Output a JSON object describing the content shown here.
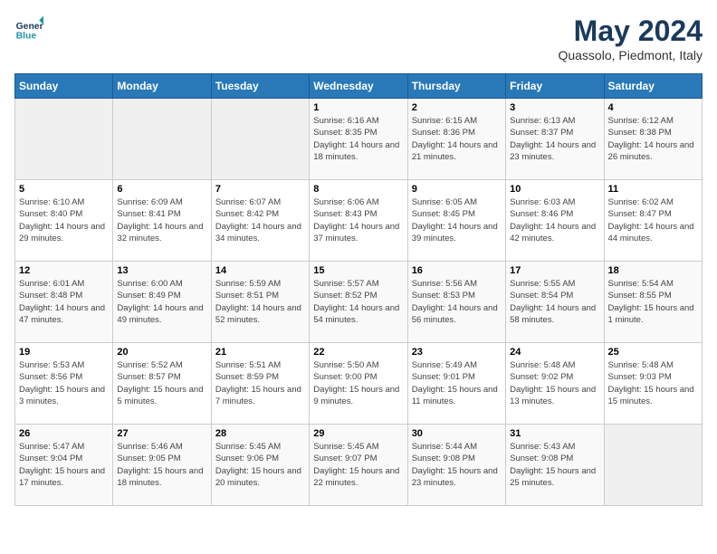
{
  "logo": {
    "text_general": "General",
    "text_blue": "Blue"
  },
  "header": {
    "title": "May 2024",
    "subtitle": "Quassolo, Piedmont, Italy"
  },
  "days_of_week": [
    "Sunday",
    "Monday",
    "Tuesday",
    "Wednesday",
    "Thursday",
    "Friday",
    "Saturday"
  ],
  "weeks": [
    [
      {
        "day": "",
        "empty": true
      },
      {
        "day": "",
        "empty": true
      },
      {
        "day": "",
        "empty": true
      },
      {
        "day": "1",
        "sunrise": "6:16 AM",
        "sunset": "8:35 PM",
        "daylight": "14 hours and 18 minutes."
      },
      {
        "day": "2",
        "sunrise": "6:15 AM",
        "sunset": "8:36 PM",
        "daylight": "14 hours and 21 minutes."
      },
      {
        "day": "3",
        "sunrise": "6:13 AM",
        "sunset": "8:37 PM",
        "daylight": "14 hours and 23 minutes."
      },
      {
        "day": "4",
        "sunrise": "6:12 AM",
        "sunset": "8:38 PM",
        "daylight": "14 hours and 26 minutes."
      }
    ],
    [
      {
        "day": "5",
        "sunrise": "6:10 AM",
        "sunset": "8:40 PM",
        "daylight": "14 hours and 29 minutes."
      },
      {
        "day": "6",
        "sunrise": "6:09 AM",
        "sunset": "8:41 PM",
        "daylight": "14 hours and 32 minutes."
      },
      {
        "day": "7",
        "sunrise": "6:07 AM",
        "sunset": "8:42 PM",
        "daylight": "14 hours and 34 minutes."
      },
      {
        "day": "8",
        "sunrise": "6:06 AM",
        "sunset": "8:43 PM",
        "daylight": "14 hours and 37 minutes."
      },
      {
        "day": "9",
        "sunrise": "6:05 AM",
        "sunset": "8:45 PM",
        "daylight": "14 hours and 39 minutes."
      },
      {
        "day": "10",
        "sunrise": "6:03 AM",
        "sunset": "8:46 PM",
        "daylight": "14 hours and 42 minutes."
      },
      {
        "day": "11",
        "sunrise": "6:02 AM",
        "sunset": "8:47 PM",
        "daylight": "14 hours and 44 minutes."
      }
    ],
    [
      {
        "day": "12",
        "sunrise": "6:01 AM",
        "sunset": "8:48 PM",
        "daylight": "14 hours and 47 minutes."
      },
      {
        "day": "13",
        "sunrise": "6:00 AM",
        "sunset": "8:49 PM",
        "daylight": "14 hours and 49 minutes."
      },
      {
        "day": "14",
        "sunrise": "5:59 AM",
        "sunset": "8:51 PM",
        "daylight": "14 hours and 52 minutes."
      },
      {
        "day": "15",
        "sunrise": "5:57 AM",
        "sunset": "8:52 PM",
        "daylight": "14 hours and 54 minutes."
      },
      {
        "day": "16",
        "sunrise": "5:56 AM",
        "sunset": "8:53 PM",
        "daylight": "14 hours and 56 minutes."
      },
      {
        "day": "17",
        "sunrise": "5:55 AM",
        "sunset": "8:54 PM",
        "daylight": "14 hours and 58 minutes."
      },
      {
        "day": "18",
        "sunrise": "5:54 AM",
        "sunset": "8:55 PM",
        "daylight": "15 hours and 1 minute."
      }
    ],
    [
      {
        "day": "19",
        "sunrise": "5:53 AM",
        "sunset": "8:56 PM",
        "daylight": "15 hours and 3 minutes."
      },
      {
        "day": "20",
        "sunrise": "5:52 AM",
        "sunset": "8:57 PM",
        "daylight": "15 hours and 5 minutes."
      },
      {
        "day": "21",
        "sunrise": "5:51 AM",
        "sunset": "8:59 PM",
        "daylight": "15 hours and 7 minutes."
      },
      {
        "day": "22",
        "sunrise": "5:50 AM",
        "sunset": "9:00 PM",
        "daylight": "15 hours and 9 minutes."
      },
      {
        "day": "23",
        "sunrise": "5:49 AM",
        "sunset": "9:01 PM",
        "daylight": "15 hours and 11 minutes."
      },
      {
        "day": "24",
        "sunrise": "5:48 AM",
        "sunset": "9:02 PM",
        "daylight": "15 hours and 13 minutes."
      },
      {
        "day": "25",
        "sunrise": "5:48 AM",
        "sunset": "9:03 PM",
        "daylight": "15 hours and 15 minutes."
      }
    ],
    [
      {
        "day": "26",
        "sunrise": "5:47 AM",
        "sunset": "9:04 PM",
        "daylight": "15 hours and 17 minutes."
      },
      {
        "day": "27",
        "sunrise": "5:46 AM",
        "sunset": "9:05 PM",
        "daylight": "15 hours and 18 minutes."
      },
      {
        "day": "28",
        "sunrise": "5:45 AM",
        "sunset": "9:06 PM",
        "daylight": "15 hours and 20 minutes."
      },
      {
        "day": "29",
        "sunrise": "5:45 AM",
        "sunset": "9:07 PM",
        "daylight": "15 hours and 22 minutes."
      },
      {
        "day": "30",
        "sunrise": "5:44 AM",
        "sunset": "9:08 PM",
        "daylight": "15 hours and 23 minutes."
      },
      {
        "day": "31",
        "sunrise": "5:43 AM",
        "sunset": "9:08 PM",
        "daylight": "15 hours and 25 minutes."
      },
      {
        "day": "",
        "empty": true
      }
    ]
  ],
  "labels": {
    "sunrise": "Sunrise:",
    "sunset": "Sunset:",
    "daylight": "Daylight:"
  }
}
